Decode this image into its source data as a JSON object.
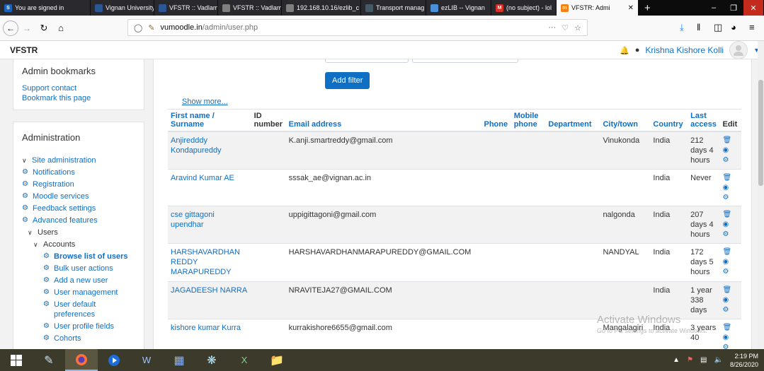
{
  "browser": {
    "tabs": [
      {
        "label": "You are signed in",
        "color": "#1565c0",
        "fav": "S",
        "active": false
      },
      {
        "label": "Vignan University::Va",
        "color": "#2b5797",
        "fav": "",
        "active": false
      },
      {
        "label": "VFSTR :: Vadlamudi",
        "color": "#2b5797",
        "fav": "",
        "active": false
      },
      {
        "label": "VFSTR :: Vadlamu",
        "color": "#7f7f7f",
        "fav": "",
        "active": false
      },
      {
        "label": "192.168.10.16/ezlib_c",
        "color": "#7f7f7f",
        "fav": "",
        "active": false
      },
      {
        "label": "Transport manag",
        "color": "#455a64",
        "fav": "",
        "active": false
      },
      {
        "label": "ezLIB -- Vignan",
        "color": "#4a90d9",
        "fav": "",
        "active": false
      },
      {
        "label": "(no subject) - lol",
        "color": "#d93025",
        "fav": "M",
        "active": false
      },
      {
        "label": "VFSTR: Admi",
        "color": "#f98012",
        "fav": "m",
        "active": true
      }
    ],
    "url_host": "vumoodle.in",
    "url_path": "/admin/user.php",
    "url_more": "···"
  },
  "header": {
    "brand": "VFSTR",
    "user_name": "Krishna Kishore Kolli"
  },
  "bookmarks": {
    "title": "Admin bookmarks",
    "links": [
      "Support contact",
      "Bookmark this page"
    ]
  },
  "admin": {
    "title": "Administration",
    "items": [
      {
        "label": "Site administration",
        "level": 1,
        "kind": "chevron"
      },
      {
        "label": "Notifications",
        "level": 1,
        "kind": "gear"
      },
      {
        "label": "Registration",
        "level": 1,
        "kind": "gear"
      },
      {
        "label": "Moodle services",
        "level": 1,
        "kind": "gear"
      },
      {
        "label": "Feedback settings",
        "level": 1,
        "kind": "gear"
      },
      {
        "label": "Advanced features",
        "level": 1,
        "kind": "gear"
      },
      {
        "label": "Users",
        "level": 2,
        "kind": "chevron"
      },
      {
        "label": "Accounts",
        "level": 3,
        "kind": "chevron"
      },
      {
        "label": "Browse list of users",
        "level": 4,
        "kind": "gear",
        "bold": true
      },
      {
        "label": "Bulk user actions",
        "level": 4,
        "kind": "gear"
      },
      {
        "label": "Add a new user",
        "level": 4,
        "kind": "gear"
      },
      {
        "label": "User management",
        "level": 4,
        "kind": "gear"
      },
      {
        "label": "User default preferences",
        "level": 4,
        "kind": "gear"
      },
      {
        "label": "User profile fields",
        "level": 4,
        "kind": "gear"
      },
      {
        "label": "Cohorts",
        "level": 4,
        "kind": "gear"
      }
    ]
  },
  "main": {
    "add_filter": "Add filter",
    "show_more": "Show more...",
    "columns": {
      "first_name": "First name",
      "sep": " / ",
      "surname": "Surname",
      "id": "ID",
      "id_number": "number",
      "email": "Email address",
      "phone": "Phone",
      "mobile": "Mobile",
      "mobile_phone": "phone",
      "department": "Department",
      "city": "City/town",
      "country": "Country",
      "last": "Last",
      "last_access": "access",
      "edit": "Edit"
    },
    "rows": [
      {
        "name": "Anjiredddy Kondapureddy",
        "email": "K.anji.smartreddy@gmail.com",
        "city": "Vinukonda",
        "country": "India",
        "access": "212 days 4 hours"
      },
      {
        "name": "Aravind Kumar AE",
        "email": "sssak_ae@vignan.ac.in",
        "city": "",
        "country": "India",
        "access": "Never"
      },
      {
        "name": "cse gittagoni upendhar",
        "email": "uppigittagoni@gmail.com",
        "city": "nalgonda",
        "country": "India",
        "access": "207 days 4 hours"
      },
      {
        "name": "HARSHAVARDHAN REDDY MARAPUREDDY",
        "email": "HARSHAVARDHANMARAPUREDDY@GMAIL.COM",
        "city": "NANDYAL",
        "country": "India",
        "access": "172 days 5 hours"
      },
      {
        "name": "JAGADEESH NARRA",
        "email": "NRAVITEJA27@GMAIL.COM",
        "city": "",
        "country": "India",
        "access": "1 year 338 days"
      },
      {
        "name": "kishore kumar Kurra",
        "email": "kurrakishore6655@gmail.com",
        "city": "Mangalagiri",
        "country": "India",
        "access": "3 years 40"
      }
    ]
  },
  "watermark": {
    "line1": "Activate Windows",
    "line2": "Go to PC settings to activate Windows."
  },
  "taskbar": {
    "time": "2:19 PM",
    "date": "8/26/2020"
  }
}
